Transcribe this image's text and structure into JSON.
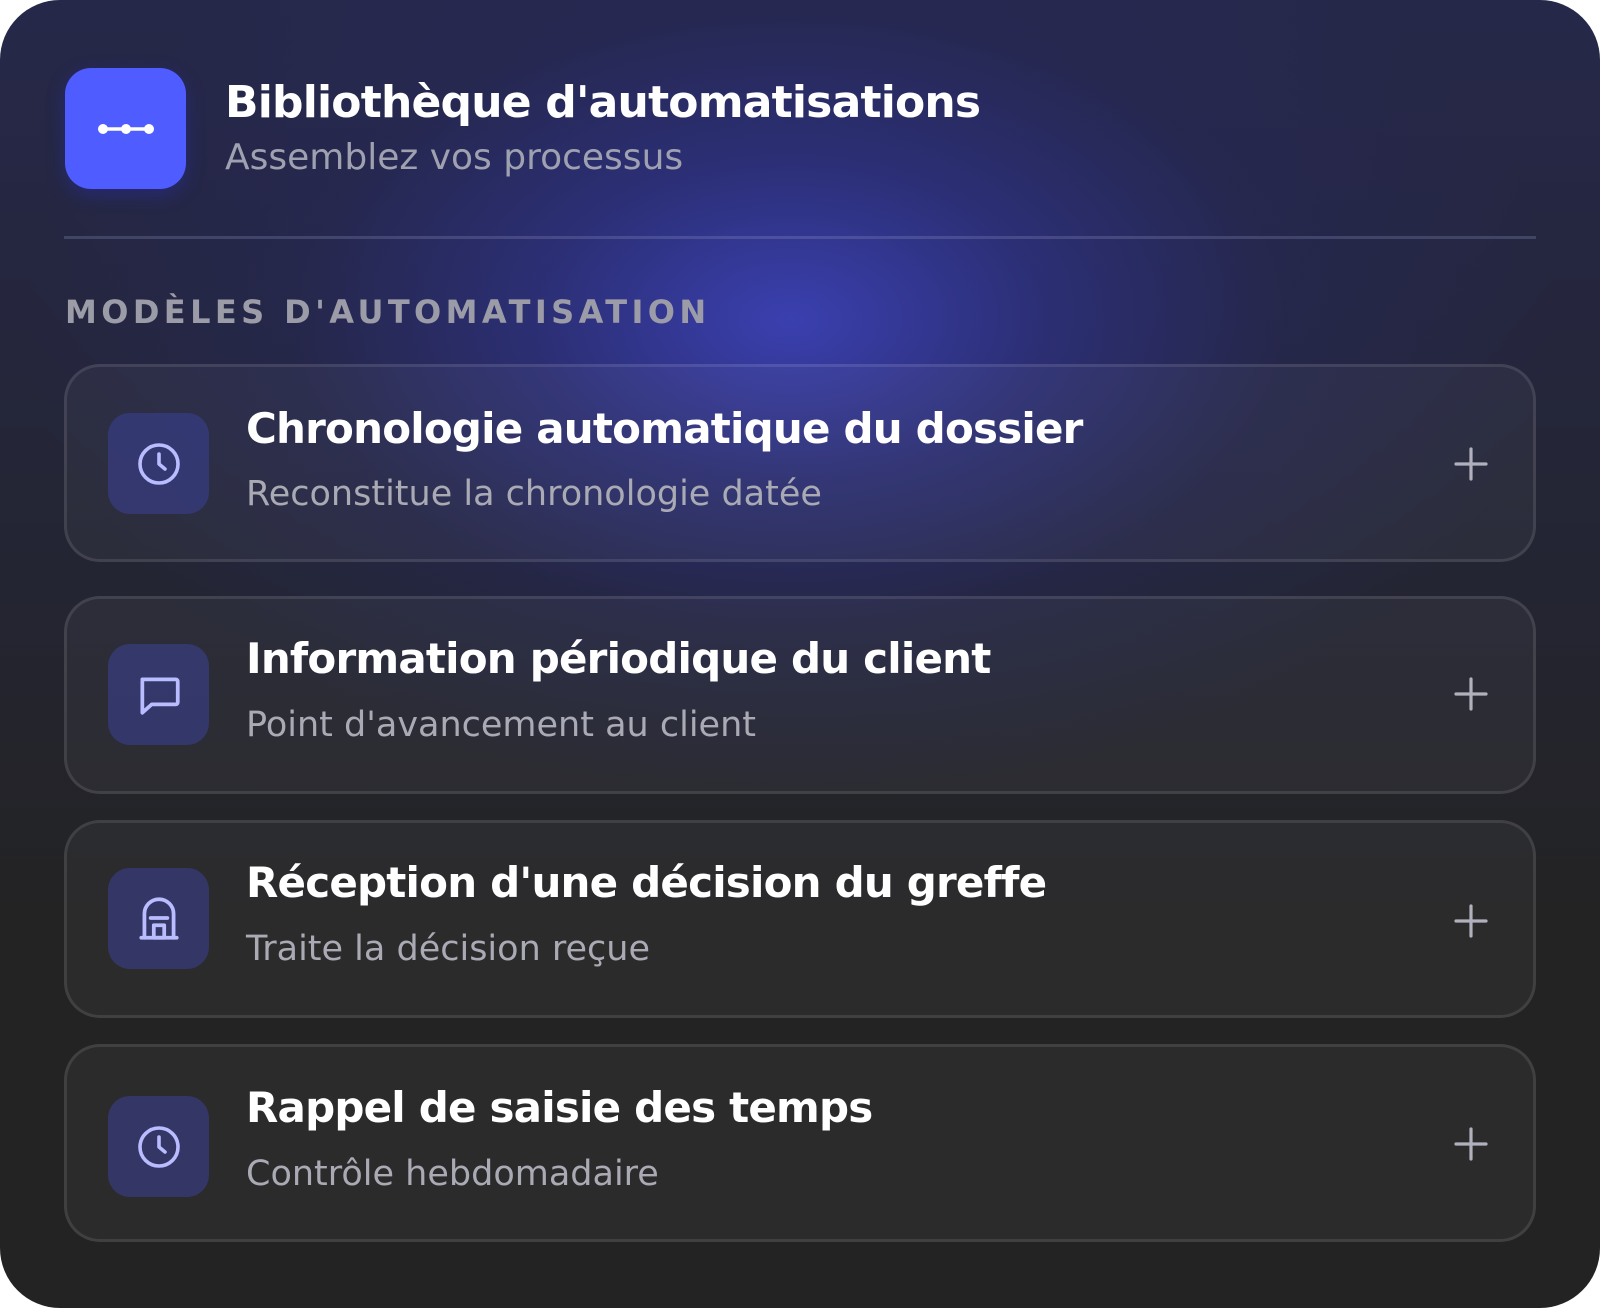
{
  "header": {
    "title": "Bibliothèque d'automatisations",
    "subtitle": "Assemblez vos processus",
    "icon": "workflow-nodes-icon",
    "accent_color": "#4f5cff"
  },
  "section": {
    "label": "MODÈLES D'AUTOMATISATION"
  },
  "templates": [
    {
      "title": "Chronologie automatique du dossier",
      "description": "Reconstitue la chronologie datée",
      "icon": "clock-icon",
      "action": "add-icon"
    },
    {
      "title": "Information périodique du client",
      "description": "Point d'avancement au client",
      "icon": "message-icon",
      "action": "add-icon"
    },
    {
      "title": "Réception d'une décision du greffe",
      "description": "Traite la décision reçue",
      "icon": "courthouse-icon",
      "action": "add-icon"
    },
    {
      "title": "Rappel de saisie des temps",
      "description": "Contrôle hebdomadaire",
      "icon": "clock-icon",
      "action": "add-icon"
    }
  ]
}
